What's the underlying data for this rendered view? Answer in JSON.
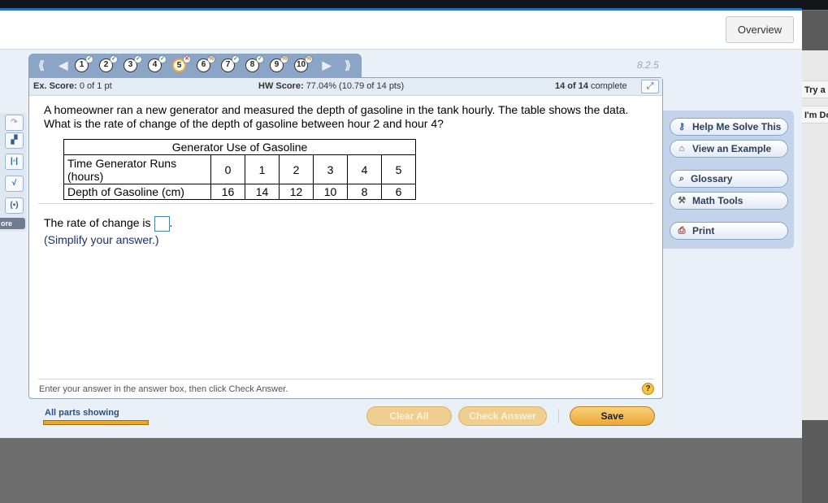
{
  "header": {
    "overview_label": "Overview"
  },
  "right_edge": {
    "tab1": "Try a",
    "tab2": "I'm Do"
  },
  "left_tools": {
    "more_label": "ore"
  },
  "navigation": {
    "first": "⟪",
    "prev": "◀",
    "next": "▶",
    "last": "⟫",
    "section": "8.2.5",
    "questions": [
      {
        "num": "1",
        "status": "correct"
      },
      {
        "num": "2",
        "status": "correct"
      },
      {
        "num": "3",
        "status": "correct"
      },
      {
        "num": "4",
        "status": "correct"
      },
      {
        "num": "5",
        "status": "incorrect",
        "current": true
      },
      {
        "num": "6",
        "status": "partial"
      },
      {
        "num": "7",
        "status": "correct"
      },
      {
        "num": "8",
        "status": "correct"
      },
      {
        "num": "9",
        "status": "partial"
      },
      {
        "num": "10",
        "status": "partial"
      }
    ]
  },
  "score": {
    "ex_label": "Ex. Score:",
    "ex_value": "0 of 1 pt",
    "hw_label": "HW Score:",
    "hw_value": "77.04% (10.79 of 14 pts)",
    "complete_count": "14 of 14",
    "complete_label": "complete"
  },
  "question": {
    "text": "A homeowner ran a new generator and measured the depth of gasoline in the tank hourly. The table shows the data. What is the rate of change of the depth of gasoline between hour 2 and hour 4?",
    "table": {
      "title": "Generator Use of Gasoline",
      "row1_label": "Time Generator Runs (hours)",
      "row1_values": [
        "0",
        "1",
        "2",
        "3",
        "4",
        "5"
      ],
      "row2_label": "Depth of Gasoline (cm)",
      "row2_values": [
        "16",
        "14",
        "12",
        "10",
        "8",
        "6"
      ]
    },
    "answer_prefix": "The rate of change is",
    "answer_suffix": ".",
    "simplify": "(Simplify your answer.)",
    "hint": "Enter your answer in the answer box, then click Check Answer.",
    "help_symbol": "?"
  },
  "sidebar": {
    "help_me_solve": "Help Me Solve This",
    "view_example": "View an Example",
    "glossary": "Glossary",
    "math_tools": "Math Tools",
    "print": "Print"
  },
  "footer": {
    "parts_label": "All parts showing",
    "parts_progress": 1.0,
    "clear_all": "Clear All",
    "check_answer": "Check Answer",
    "save": "Save"
  }
}
